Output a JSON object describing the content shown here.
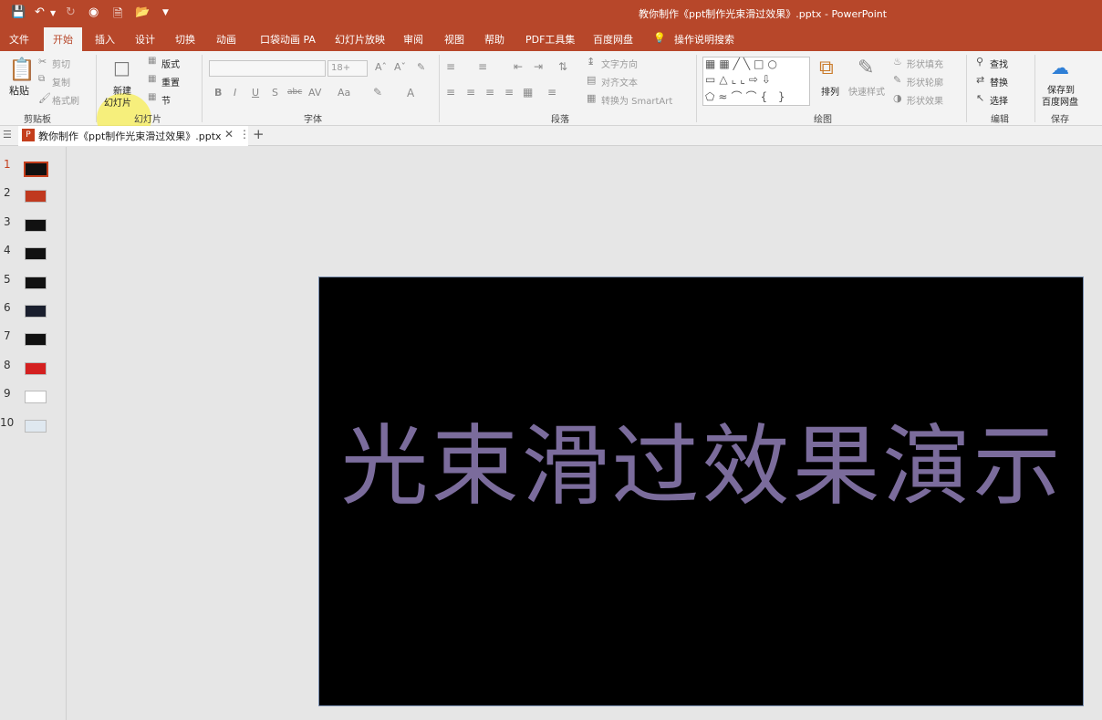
{
  "window": {
    "title": "教你制作《ppt制作光束滑过效果》.pptx - PowerPoint"
  },
  "qat": {
    "save_icon": "save-icon",
    "undo_icon": "undo-icon",
    "redo_icon": "redo-icon"
  },
  "tabs": [
    "文件",
    "开始",
    "插入",
    "设计",
    "切换",
    "动画",
    "口袋动画 PA",
    "幻灯片放映",
    "审阅",
    "视图",
    "帮助",
    "PDF工具集",
    "百度网盘"
  ],
  "tell_me": "操作说明搜索",
  "ribbon": {
    "clipboard": {
      "paste": "粘贴",
      "cut": "剪切",
      "copy": "复制",
      "format_painter": "格式刷",
      "label": "剪贴板"
    },
    "slides": {
      "new_slide_1": "新建",
      "new_slide_2": "幻灯片",
      "layout": "版式",
      "reset": "重置",
      "section": "节",
      "label": "幻灯片"
    },
    "font": {
      "size": "18+",
      "label": "字体",
      "bold": "B",
      "italic": "I",
      "underline": "U",
      "shadow": "S",
      "strike": "abc"
    },
    "paragraph": {
      "text_direction": "文字方向",
      "align_text": "对齐文本",
      "smartart": "转换为 SmartArt",
      "label": "段落"
    },
    "drawing": {
      "arrange": "排列",
      "quick_styles": "快速样式",
      "shape_fill": "形状填充",
      "shape_outline": "形状轮廓",
      "shape_effects": "形状效果",
      "label": "绘图"
    },
    "editing": {
      "find": "查找",
      "replace": "替换",
      "select": "选择",
      "label": "编辑"
    },
    "save": {
      "line1": "保存到",
      "line2": "百度网盘",
      "label": "保存"
    }
  },
  "doc_tab": {
    "name": "教你制作《ppt制作光束滑过效果》.pptx"
  },
  "slides": [
    {
      "num": "1",
      "color": "#111111"
    },
    {
      "num": "2",
      "color": "#c0391f"
    },
    {
      "num": "3",
      "color": "#111111"
    },
    {
      "num": "4",
      "color": "#111111"
    },
    {
      "num": "5",
      "color": "#111111"
    },
    {
      "num": "6",
      "color": "#1a1f2e"
    },
    {
      "num": "7",
      "color": "#111111"
    },
    {
      "num": "8",
      "color": "#d42020"
    },
    {
      "num": "9",
      "color": "#ffffff"
    },
    {
      "num": "10",
      "color": "#dfe8f0"
    }
  ],
  "current_slide": {
    "title": "光束滑过效果演示",
    "bg": "#000000",
    "text_color": "#7b6c9c"
  },
  "colors": {
    "accent": "#b7472a"
  }
}
